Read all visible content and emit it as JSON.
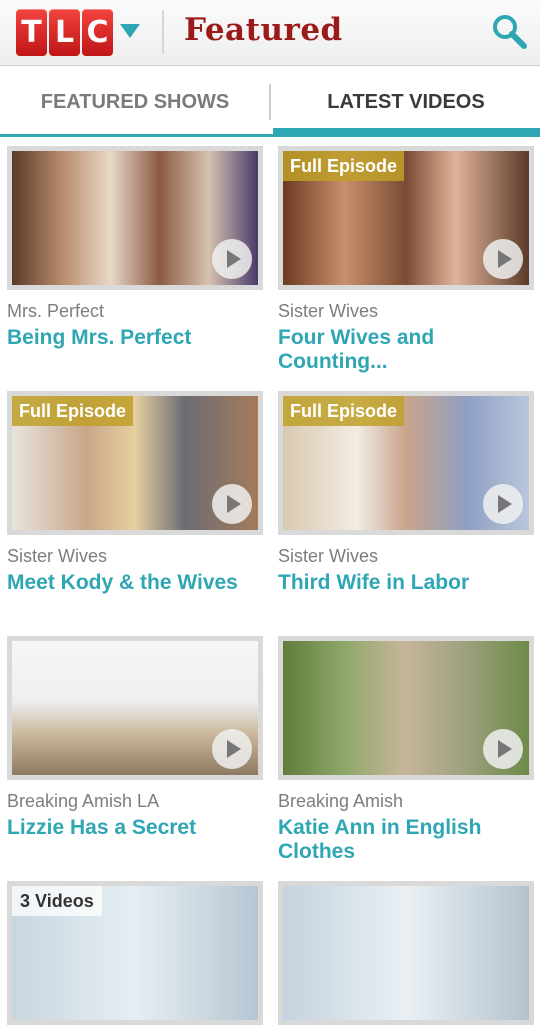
{
  "header": {
    "logo_letters": [
      "T",
      "L",
      "C"
    ],
    "title": "Featured"
  },
  "tabs": [
    {
      "label": "FEATURED SHOWS",
      "active": false
    },
    {
      "label": "LATEST VIDEOS",
      "active": true
    }
  ],
  "videos": [
    {
      "show": "Mrs. Perfect",
      "title": "Being Mrs. Perfect",
      "badge": ""
    },
    {
      "show": "Sister Wives",
      "title": "Four Wives and Counting...",
      "badge": "Full Episode"
    },
    {
      "show": "Sister Wives",
      "title": "Meet Kody & the Wives",
      "badge": "Full Episode"
    },
    {
      "show": "Sister Wives",
      "title": "Third Wife in Labor",
      "badge": "Full Episode"
    },
    {
      "show": "Breaking Amish LA",
      "title": "Lizzie Has a Secret",
      "badge": ""
    },
    {
      "show": "Breaking Amish",
      "title": "Katie Ann in English Clothes",
      "badge": ""
    },
    {
      "show": "",
      "title": "",
      "badge": "3 Videos"
    },
    {
      "show": "",
      "title": "",
      "badge": ""
    }
  ],
  "colors": {
    "accent": "#2fa6b4",
    "title_red": "#9b1b1b",
    "logo_red": "#e0332f",
    "badge_gold": "#bea028"
  }
}
